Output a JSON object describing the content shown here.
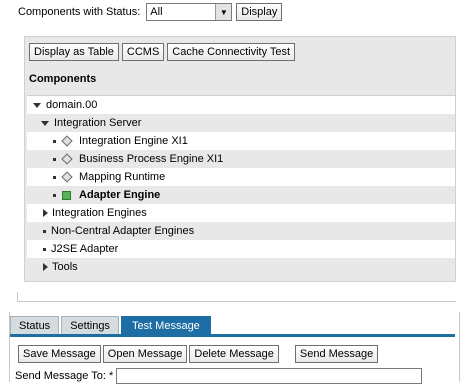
{
  "filter": {
    "label": "Components with Status:",
    "selected": "All",
    "display_button": "Display"
  },
  "panel": {
    "buttons": [
      "Display as Table",
      "CCMS",
      "Cache Connectivity Test"
    ],
    "heading": "Components",
    "tree": {
      "domain": "domain.00",
      "integration_server": "Integration Server",
      "children": [
        "Integration Engine XI1",
        "Business Process Engine XI1",
        "Mapping Runtime",
        "Adapter Engine"
      ],
      "others": [
        "Integration Engines",
        "Non-Central Adapter Engines",
        "J2SE Adapter",
        "Tools"
      ]
    }
  },
  "tabs": [
    "Status",
    "Settings",
    "Test Message"
  ],
  "message_toolbar": {
    "save": "Save Message",
    "open": "Open Message",
    "delete": "Delete Message",
    "send": "Send Message"
  },
  "send_to": {
    "label": "Send Message To: *",
    "value": ""
  },
  "colors": {
    "active_tab": "#1c6ea4",
    "panel_bg": "#e8e8e8",
    "status_green": "#57b35a"
  }
}
